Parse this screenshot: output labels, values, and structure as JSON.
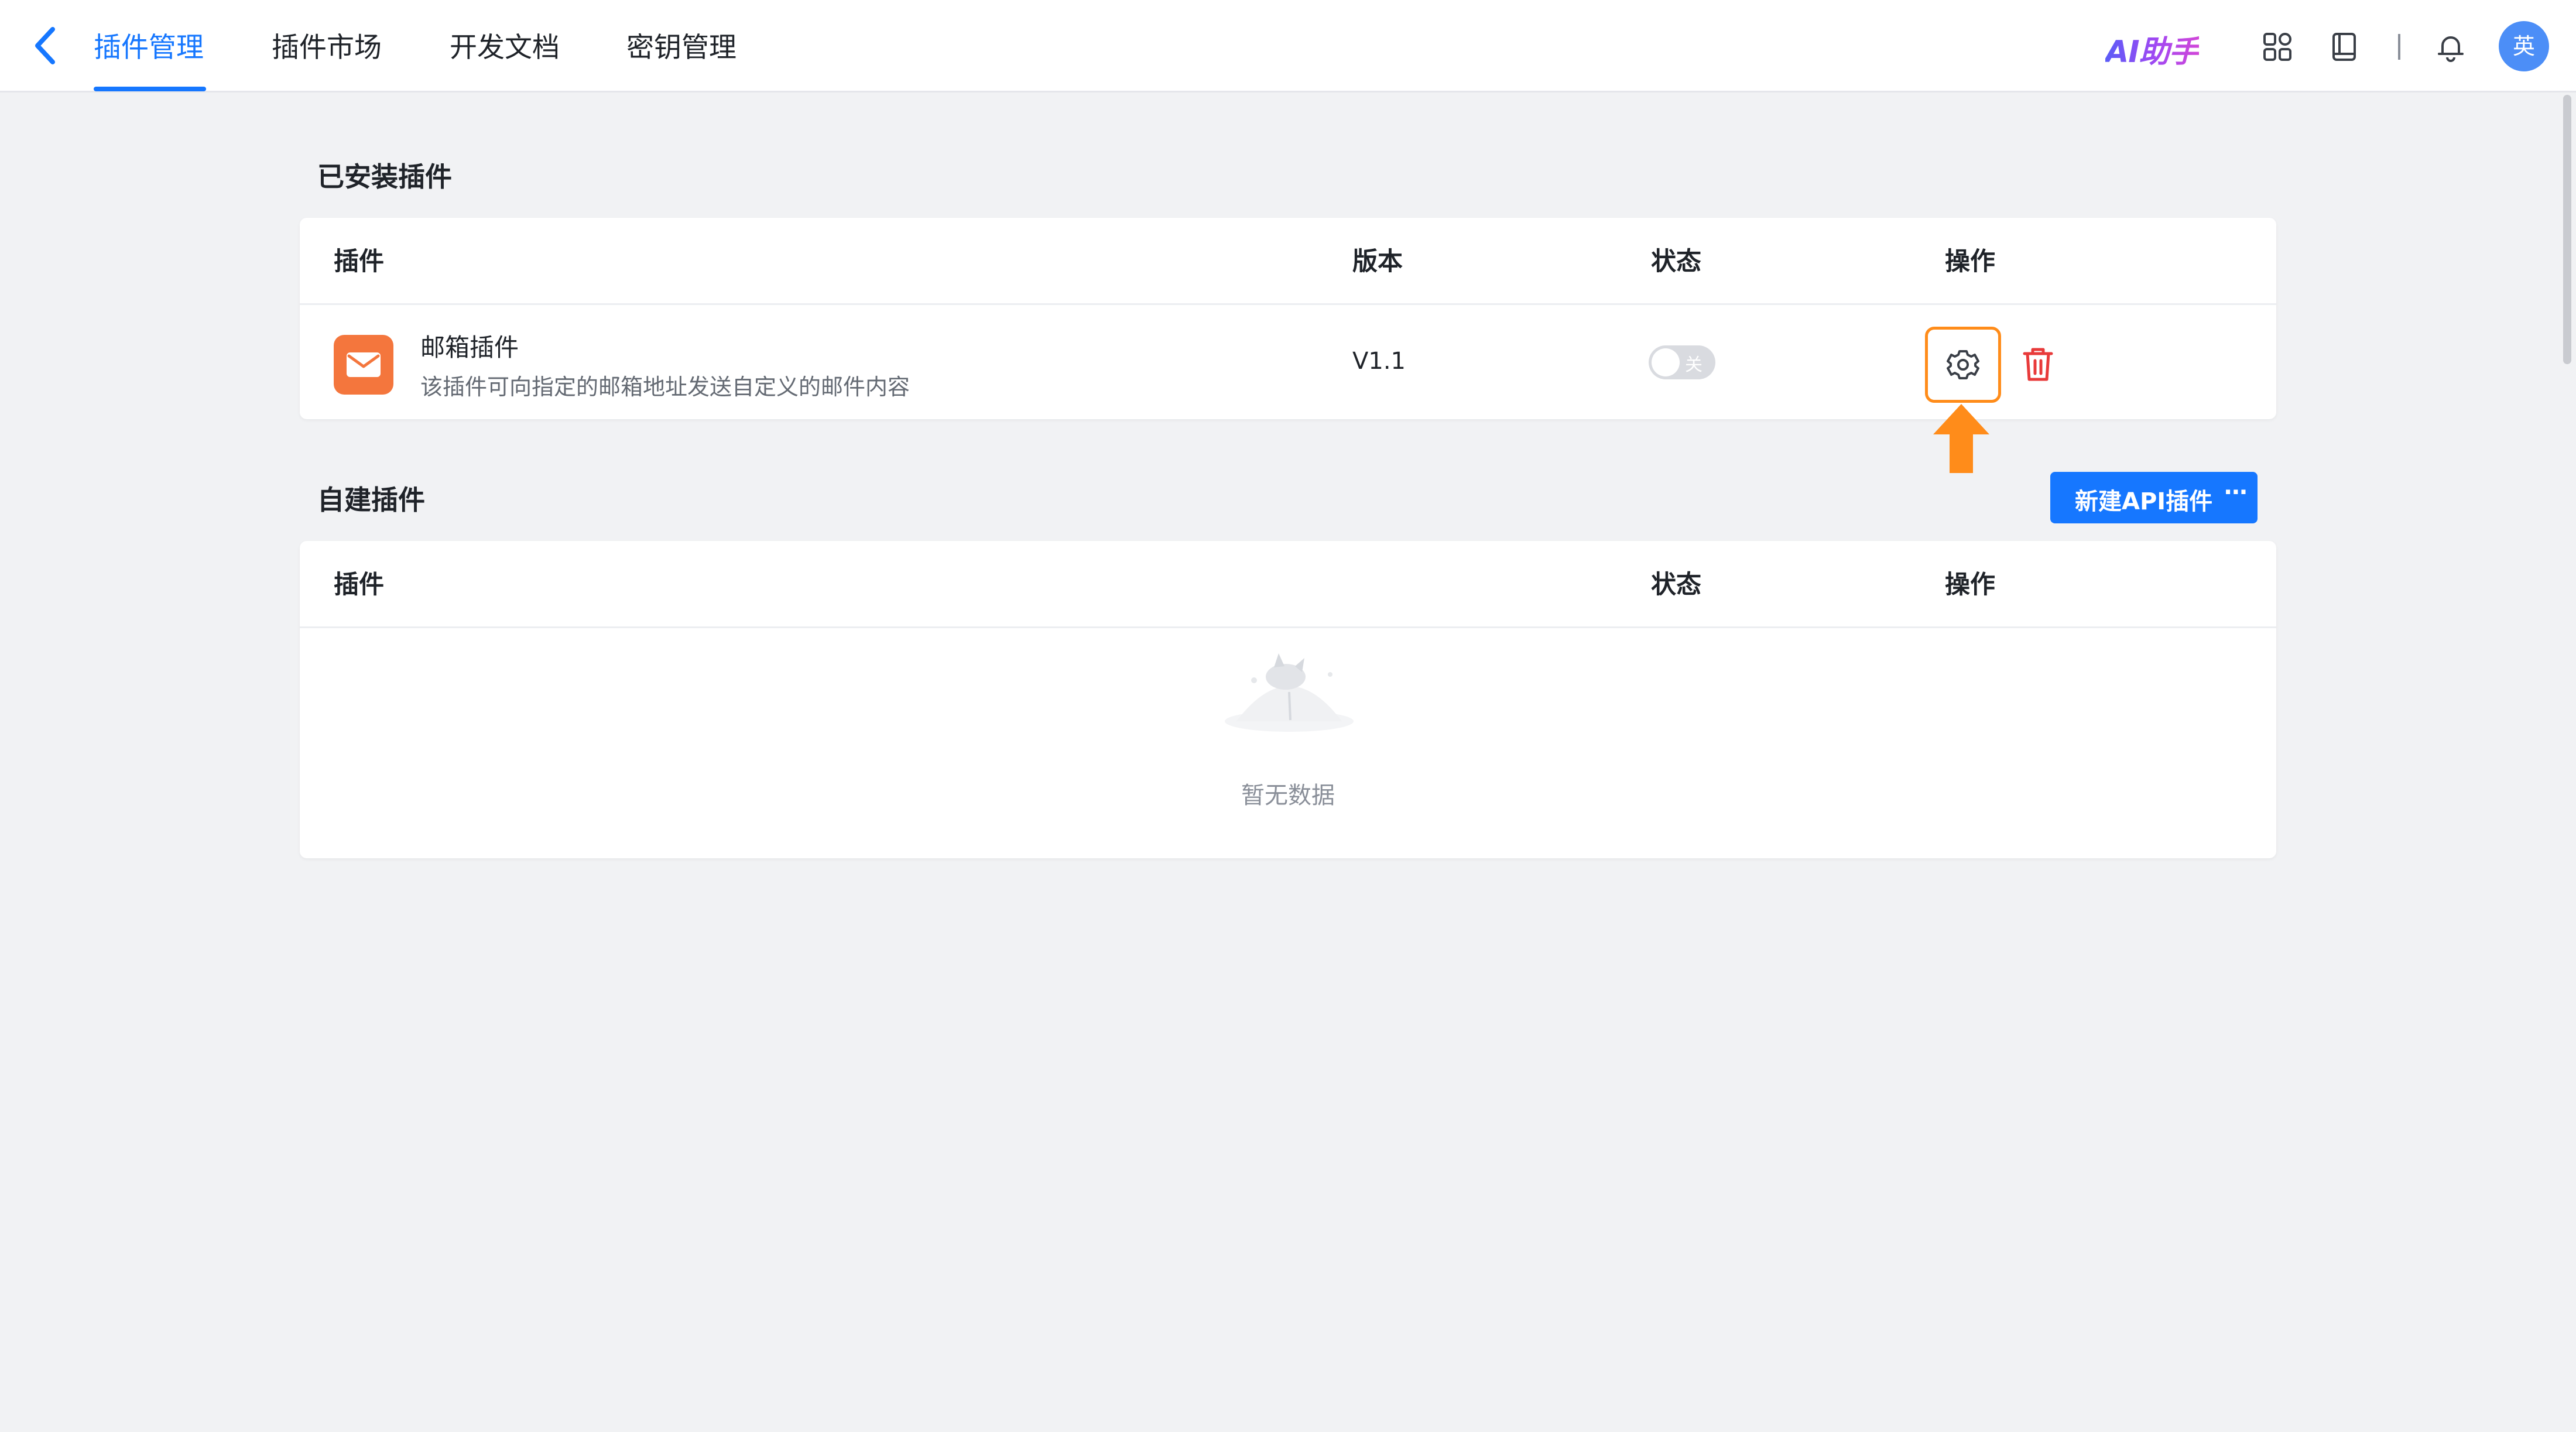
{
  "nav": {
    "tabs": [
      "插件管理",
      "插件市场",
      "开发文档",
      "密钥管理"
    ],
    "active_tab": "插件管理",
    "ai_assistant": "AI助手",
    "avatar_text": "英",
    "accent_color": "#1677ff"
  },
  "installed": {
    "title": "已安装插件",
    "columns": {
      "plugin": "插件",
      "version": "版本",
      "status": "状态",
      "actions": "操作"
    },
    "rows": [
      {
        "icon": "mail-icon",
        "name": "邮箱插件",
        "description": "该插件可向指定的邮箱地址发送自定义的邮件内容",
        "version": "V1.1",
        "status_label": "关",
        "enabled": false
      }
    ]
  },
  "custom": {
    "title": "自建插件",
    "new_button": "新建API插件",
    "more_label": "···",
    "columns": {
      "plugin": "插件",
      "status": "状态",
      "actions": "操作"
    },
    "empty_text": "暂无数据"
  },
  "colors": {
    "highlight": "#ff8c1a",
    "danger": "#e83a3a",
    "plugin_icon": "#f4763d",
    "avatar": "#4c8ef7"
  }
}
